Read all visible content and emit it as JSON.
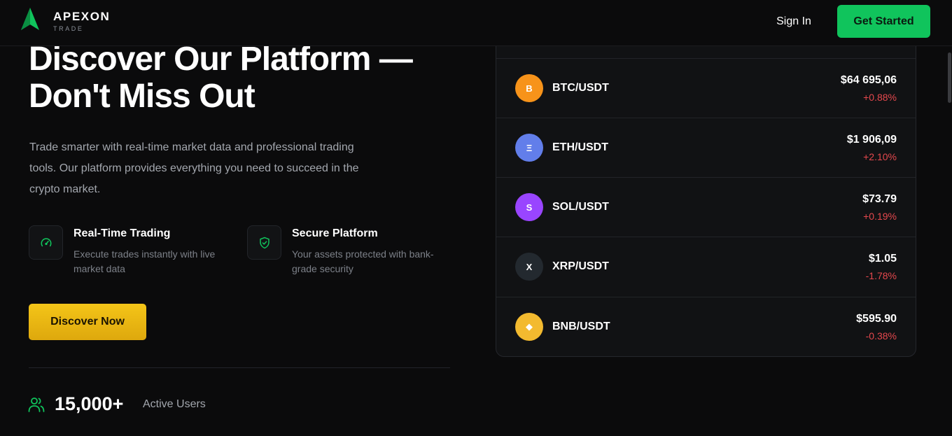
{
  "header": {
    "brand_name": "APEXON",
    "brand_sub": "TRADE",
    "signin_label": "Sign In",
    "get_started_label": "Get Started"
  },
  "hero": {
    "title_line1": "Discover Our Platform —",
    "title_line2": "Don't Miss Out",
    "description": "Trade smarter with real-time market data and professional trading tools. Our platform provides everything you need to succeed in the crypto market.",
    "features": [
      {
        "title": "Real-Time Trading",
        "description": "Execute trades instantly with live market data",
        "icon": "speedometer-icon"
      },
      {
        "title": "Secure Platform",
        "description": "Your assets protected with bank-grade security",
        "icon": "shield-check-icon"
      }
    ],
    "cta_label": "Discover Now",
    "stat": {
      "value": "15,000+",
      "label": "Active Users",
      "icon": "users-icon"
    }
  },
  "market": {
    "rows": [
      {
        "symbol": "B",
        "pair": "BTC/USDT",
        "price": "$64 695,06",
        "change": "+0.88%",
        "color": "#f7931a"
      },
      {
        "symbol": "Ξ",
        "pair": "ETH/USDT",
        "price": "$1 906,09",
        "change": "+2.10%",
        "color": "#627eea"
      },
      {
        "symbol": "S",
        "pair": "SOL/USDT",
        "price": "$73.79",
        "change": "+0.19%",
        "color": "#9945ff"
      },
      {
        "symbol": "X",
        "pair": "XRP/USDT",
        "price": "$1.05",
        "change": "-1.78%",
        "color": "#23292f"
      },
      {
        "symbol": "◆",
        "pair": "BNB/USDT",
        "price": "$595.90",
        "change": "-0.38%",
        "color": "#f3ba2f"
      }
    ]
  },
  "colors": {
    "accent_green": "#10c45c",
    "accent_yellow": "#f4c518",
    "change_red": "#e5484d",
    "background": "#0b0b0c"
  }
}
